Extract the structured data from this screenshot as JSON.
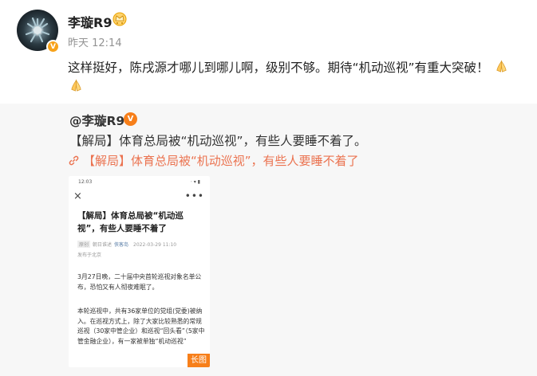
{
  "post": {
    "username": "李璇R9",
    "timestamp": "昨天 12:14",
    "text_line1": "这样挺好，陈戌源才哪儿到哪儿啊，级别不够。期待“机动巡视”有重大突破！",
    "verified_mark": "V"
  },
  "quote": {
    "username": "@李璇R9",
    "verified_mark": "V",
    "text": "【解局】体育总局被“机动巡视”，有些人要睡不着了。",
    "link_text": "【解局】体育总局被“机动巡视”，有些人要睡不着了"
  },
  "image": {
    "status_time": "12:03",
    "status_icons": "⋅ ▾ ▮",
    "close": "×",
    "more": "•••",
    "title": "【解局】体育总局被“机动巡视”，有些人要睡不着了",
    "meta_tag": "原创",
    "meta_source": "朝日谁述",
    "meta_author": "侠客岛",
    "meta_date": "2022-03-29 11:10",
    "location": "发布于北京",
    "para1": "3月27日晚，二十届中央首轮巡视对象名单公布，恐怕又有人彻夜难眠了。",
    "para2": "本轮巡视中，共有36家单位的党组(党委)被纳入。在巡视方式上，除了大家比较熟悉的常规巡视（30家中管企业）和巡视“回头看”（5家中管金融企业），有一家被单独“机动巡视”",
    "long_badge": "长图"
  },
  "colors": {
    "link": "#eb7350",
    "badge_orange": "#f77f1a",
    "quote_bg": "#f7f7f7"
  }
}
